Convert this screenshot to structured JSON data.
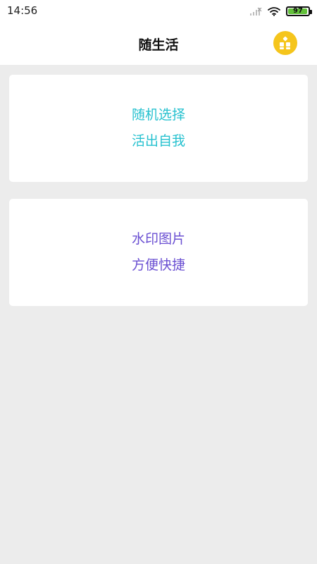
{
  "status_bar": {
    "time": "14:56",
    "battery": "97",
    "battery_level": 0.97
  },
  "header": {
    "title": "随生活",
    "menu_icon": "grid-icon",
    "menu_color": "#f5c51c"
  },
  "cards": [
    {
      "line1": "随机选择",
      "line2": "活出自我",
      "color": "#26c1cf"
    },
    {
      "line1": "水印图片",
      "line2": "方便快捷",
      "color": "#6a4fd2"
    }
  ]
}
